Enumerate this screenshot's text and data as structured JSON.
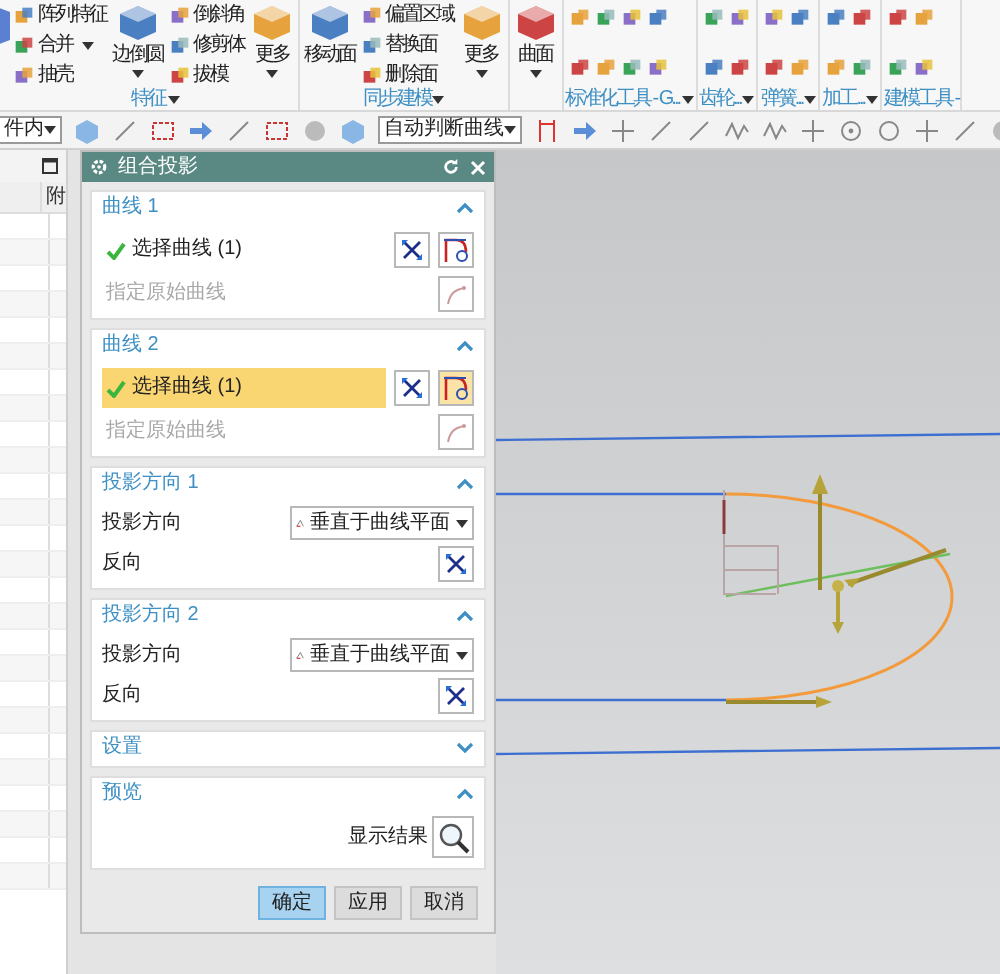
{
  "ribbon": {
    "groups": [
      {
        "kind": "buttons",
        "label": "特征",
        "launcher": true,
        "columns": [
          {
            "kind": "small",
            "items": [
              {
                "label": "阵列特征",
                "menu": false
              },
              {
                "label": "合并",
                "menu": true
              },
              {
                "label": "抽壳",
                "menu": false
              }
            ]
          },
          {
            "kind": "large",
            "items": [
              {
                "label": "边倒圆",
                "menu": true
              }
            ]
          },
          {
            "kind": "small",
            "items": [
              {
                "label": "倒斜角",
                "menu": false
              },
              {
                "label": "修剪体",
                "menu": false
              },
              {
                "label": "拔模",
                "menu": false
              }
            ]
          },
          {
            "kind": "large",
            "items": [
              {
                "label": "更多",
                "menu": true
              }
            ]
          }
        ]
      },
      {
        "kind": "buttons",
        "label": "同步建模",
        "launcher": true,
        "columns": [
          {
            "kind": "large",
            "items": [
              {
                "label": "移动面",
                "menu": false
              }
            ]
          },
          {
            "kind": "small",
            "items": [
              {
                "label": "偏置区域",
                "menu": false
              },
              {
                "label": "替换面",
                "menu": false
              },
              {
                "label": "删除面",
                "menu": false
              }
            ]
          },
          {
            "kind": "large",
            "items": [
              {
                "label": "更多",
                "menu": true
              }
            ]
          }
        ]
      },
      {
        "kind": "buttons",
        "launcher": false,
        "columns": [
          {
            "kind": "large",
            "items": [
              {
                "label": "曲面",
                "menu": true
              }
            ]
          }
        ]
      },
      {
        "kind": "tools",
        "label": "标准化工具 - G...",
        "launcher": true
      },
      {
        "kind": "tools",
        "label": "齿轮...",
        "launcher": true
      },
      {
        "kind": "tools",
        "label": "弹簧...",
        "launcher": true
      },
      {
        "kind": "tools",
        "label": "加工...",
        "launcher": true
      },
      {
        "kind": "tools",
        "label": "建模工具 -",
        "launcher": false
      }
    ]
  },
  "toolbar": {
    "filter": "件内",
    "curve_rule": "自动判断曲线"
  },
  "navigator": {
    "column_2": "附"
  },
  "dialog": {
    "title": "组合投影",
    "sections": [
      {
        "kind": "curve",
        "title": "曲线 1",
        "expanded": true,
        "select": {
          "label": "选择曲线 (1)",
          "done": true,
          "selected": false
        },
        "hint": "指定原始曲线"
      },
      {
        "kind": "curve",
        "title": "曲线 2",
        "expanded": true,
        "select": {
          "label": "选择曲线 (1)",
          "done": true,
          "selected": true
        },
        "hint": "指定原始曲线"
      },
      {
        "kind": "direction",
        "title": "投影方向 1",
        "expanded": true,
        "label": "投影方向",
        "value": "垂直于曲线平面",
        "reverse": "反向"
      },
      {
        "kind": "direction",
        "title": "投影方向 2",
        "expanded": true,
        "label": "投影方向",
        "value": "垂直于曲线平面",
        "reverse": "反向"
      },
      {
        "kind": "settings",
        "title": "设置",
        "expanded": false
      },
      {
        "kind": "preview",
        "title": "预览",
        "expanded": true,
        "label": "显示结果"
      }
    ],
    "buttons": [
      {
        "label": "确定",
        "default": true
      },
      {
        "label": "应用",
        "default": false
      },
      {
        "label": "取消",
        "default": false
      }
    ]
  }
}
